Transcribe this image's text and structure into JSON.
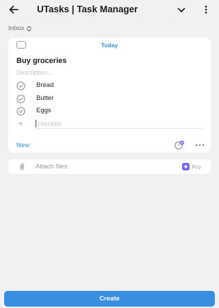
{
  "header": {
    "title": "UTasks | Task Manager"
  },
  "list_selector": {
    "label": "Inbox"
  },
  "task": {
    "date_label": "Today",
    "title": "Buy groceries",
    "description_placeholder": "Description...",
    "checklist": [
      {
        "label": "Bread"
      },
      {
        "label": "Butter"
      },
      {
        "label": "Eggs"
      }
    ],
    "checklist_placeholder": "checklist",
    "new_label": "New"
  },
  "attachments": {
    "label": "Attach files",
    "pro_badge": "Pro"
  },
  "footer": {
    "create_label": "Create"
  },
  "colors": {
    "accent": "#2f8fd6",
    "button": "#3a8ee0",
    "pro": "#7b61ff",
    "background": "#f1f1f3"
  }
}
